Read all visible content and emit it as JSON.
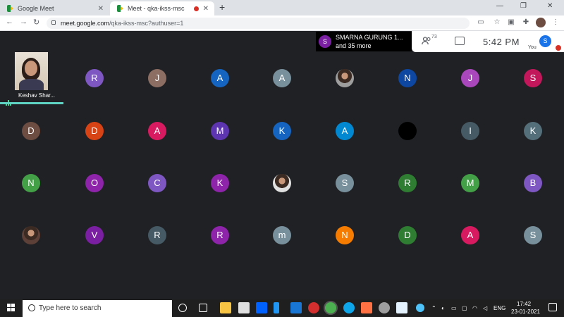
{
  "browser": {
    "tabs": [
      {
        "label": "Google Meet"
      },
      {
        "label": "Meet - qka-ikss-msc"
      }
    ],
    "new_tab": "+",
    "close": "✕",
    "url_host": "meet.google.com",
    "url_path": "/qka-ikss-msc?authuser=1"
  },
  "meet": {
    "presenter_initial": "S",
    "presenter_name": "SMARNA GURUNG 1...",
    "presenter_more": "and 35 more",
    "people_count": "73",
    "time": "5:42 PM",
    "self_initial": "S",
    "self_label": "You",
    "main_speaker": "Keshav Shar...",
    "tiles": [
      {
        "row": 0,
        "col": 1,
        "initial": "R",
        "color": "#7e57c2"
      },
      {
        "row": 0,
        "col": 2,
        "initial": "J",
        "color": "#8d6e63"
      },
      {
        "row": 0,
        "col": 3,
        "initial": "A",
        "color": "#1565c0"
      },
      {
        "row": 0,
        "col": 4,
        "initial": "A",
        "color": "#78909c"
      },
      {
        "row": 0,
        "col": 5,
        "initial": "",
        "color": "#9e9e9e",
        "photo": true
      },
      {
        "row": 0,
        "col": 6,
        "initial": "N",
        "color": "#0d47a1"
      },
      {
        "row": 0,
        "col": 7,
        "initial": "J",
        "color": "#ab47bc"
      },
      {
        "row": 0,
        "col": 8,
        "initial": "S",
        "color": "#c2185b"
      },
      {
        "row": 1,
        "col": 0,
        "initial": "D",
        "color": "#6d4c41"
      },
      {
        "row": 1,
        "col": 1,
        "initial": "D",
        "color": "#d84315"
      },
      {
        "row": 1,
        "col": 2,
        "initial": "A",
        "color": "#d81b60"
      },
      {
        "row": 1,
        "col": 3,
        "initial": "M",
        "color": "#5e35b1"
      },
      {
        "row": 1,
        "col": 4,
        "initial": "K",
        "color": "#1565c0"
      },
      {
        "row": 1,
        "col": 5,
        "initial": "A",
        "color": "#0288d1"
      },
      {
        "row": 1,
        "col": 6,
        "initial": "",
        "color": "#000000"
      },
      {
        "row": 1,
        "col": 7,
        "initial": "I",
        "color": "#455a64"
      },
      {
        "row": 1,
        "col": 8,
        "initial": "K",
        "color": "#546e7a"
      },
      {
        "row": 2,
        "col": 0,
        "initial": "N",
        "color": "#43a047"
      },
      {
        "row": 2,
        "col": 1,
        "initial": "O",
        "color": "#8e24aa"
      },
      {
        "row": 2,
        "col": 2,
        "initial": "C",
        "color": "#7e57c2"
      },
      {
        "row": 2,
        "col": 3,
        "initial": "K",
        "color": "#8e24aa"
      },
      {
        "row": 2,
        "col": 4,
        "initial": "",
        "color": "#e0e0e0",
        "photo": true
      },
      {
        "row": 2,
        "col": 5,
        "initial": "S",
        "color": "#78909c"
      },
      {
        "row": 2,
        "col": 6,
        "initial": "R",
        "color": "#2e7d32"
      },
      {
        "row": 2,
        "col": 7,
        "initial": "M",
        "color": "#43a047"
      },
      {
        "row": 2,
        "col": 8,
        "initial": "B",
        "color": "#7e57c2"
      },
      {
        "row": 3,
        "col": 0,
        "initial": "",
        "color": "#5d4037",
        "photo": true
      },
      {
        "row": 3,
        "col": 1,
        "initial": "V",
        "color": "#7b1fa2"
      },
      {
        "row": 3,
        "col": 2,
        "initial": "R",
        "color": "#455a64"
      },
      {
        "row": 3,
        "col": 3,
        "initial": "R",
        "color": "#8e24aa"
      },
      {
        "row": 3,
        "col": 4,
        "initial": "m",
        "color": "#78909c"
      },
      {
        "row": 3,
        "col": 5,
        "initial": "N",
        "color": "#f57c00"
      },
      {
        "row": 3,
        "col": 6,
        "initial": "D",
        "color": "#2e7d32"
      },
      {
        "row": 3,
        "col": 7,
        "initial": "A",
        "color": "#d81b60"
      },
      {
        "row": 3,
        "col": 8,
        "initial": "S",
        "color": "#78909c"
      }
    ]
  },
  "taskbar": {
    "search_placeholder": "Type here to search",
    "lang": "ENG",
    "time": "17:42",
    "date": "23-01-2021"
  }
}
